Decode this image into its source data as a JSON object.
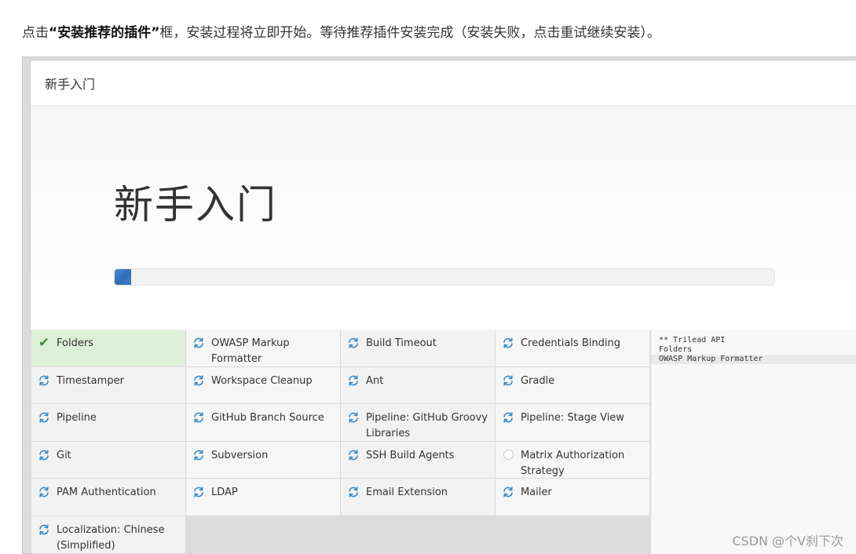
{
  "intro": {
    "prefix": "点击",
    "quote_open": "“",
    "bold": "安装推荐的插件",
    "quote_close": "”",
    "suffix": "框，安装过程将立即开始。等待推荐插件安装完成（安装失败，点击重试继续安装）。"
  },
  "dialog": {
    "header_title": "新手入门",
    "big_title": "新手入门",
    "progress_fraction": 0.025
  },
  "colors": {
    "accent": "#2f6fb7",
    "success_bg": "#dff0d8",
    "check": "#3c8d3c"
  },
  "plugins": [
    {
      "label": "Folders",
      "status": "done"
    },
    {
      "label": "OWASP Markup Formatter",
      "status": "installing"
    },
    {
      "label": "Build Timeout",
      "status": "installing"
    },
    {
      "label": "Credentials Binding",
      "status": "installing"
    },
    {
      "label": "Timestamper",
      "status": "installing"
    },
    {
      "label": "Workspace Cleanup",
      "status": "installing"
    },
    {
      "label": "Ant",
      "status": "installing"
    },
    {
      "label": "Gradle",
      "status": "installing"
    },
    {
      "label": "Pipeline",
      "status": "installing"
    },
    {
      "label": "GitHub Branch Source",
      "status": "installing"
    },
    {
      "label": "Pipeline: GitHub Groovy Libraries",
      "status": "installing"
    },
    {
      "label": "Pipeline: Stage View",
      "status": "installing"
    },
    {
      "label": "Git",
      "status": "installing"
    },
    {
      "label": "Subversion",
      "status": "installing"
    },
    {
      "label": "SSH Build Agents",
      "status": "installing"
    },
    {
      "label": "Matrix Authorization Strategy",
      "status": "pending"
    },
    {
      "label": "PAM Authentication",
      "status": "installing"
    },
    {
      "label": "LDAP",
      "status": "installing"
    },
    {
      "label": "Email Extension",
      "status": "installing"
    },
    {
      "label": "Mailer",
      "status": "installing"
    },
    {
      "label": "Localization: Chinese (Simplified)",
      "status": "installing"
    }
  ],
  "log": {
    "lines": [
      "** Trilead API",
      "Folders",
      "OWASP Markup Formatter"
    ]
  },
  "watermark": "CSDN @个V刹下次"
}
